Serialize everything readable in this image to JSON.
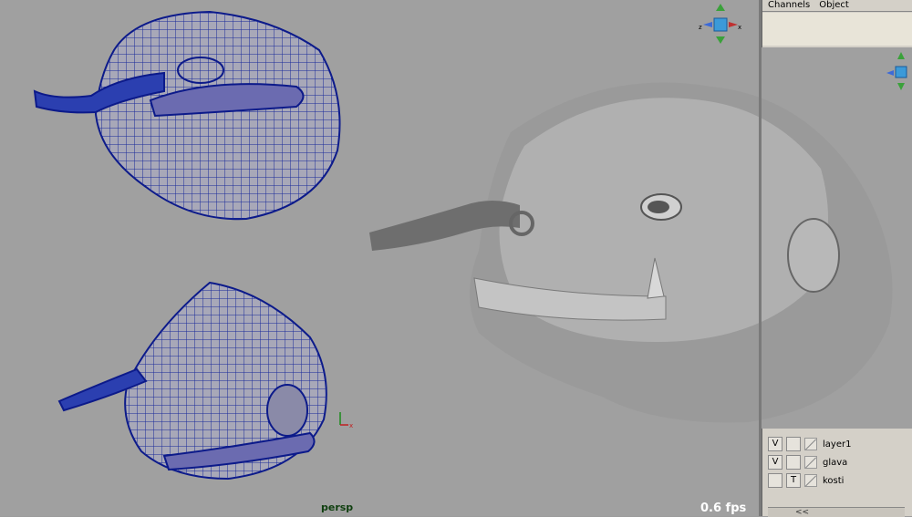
{
  "viewport": {
    "camera_label": "persp",
    "fps": "0.6 fps"
  },
  "channel_box": {
    "tabs": [
      "Channels",
      "Object"
    ]
  },
  "layers": [
    {
      "visible": "V",
      "template": "",
      "name": "layer1"
    },
    {
      "visible": "V",
      "template": "",
      "name": "glava"
    },
    {
      "visible": "",
      "template": "T",
      "name": "kosti"
    }
  ],
  "scroll": {
    "left": "<<",
    "right": ""
  },
  "axis": {
    "x": "x",
    "y": "y",
    "z": "z"
  }
}
